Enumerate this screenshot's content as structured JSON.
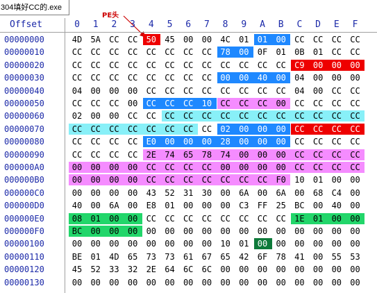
{
  "window": {
    "tab_title": "304填好CC的.exe"
  },
  "annotation": {
    "text": "PE头"
  },
  "header": {
    "offset_label": "Offset",
    "columns": [
      "0",
      "1",
      "2",
      "3",
      "4",
      "5",
      "6",
      "7",
      "8",
      "9",
      "A",
      "B",
      "C",
      "D",
      "E",
      "F"
    ]
  },
  "highlight_colors": {
    "blue": "#1e88ff",
    "red": "#ee0000",
    "magenta": "#f58cff",
    "cyan": "#88f0f8",
    "green": "#22d66a",
    "dark_green": "#0e7a3a"
  },
  "rows": [
    {
      "offset": "00000000",
      "bytes": [
        "4D",
        "5A",
        "CC",
        "CC",
        "50",
        "45",
        "00",
        "00",
        "4C",
        "01",
        "01",
        "00",
        "CC",
        "CC",
        "CC",
        "CC"
      ],
      "highlights": [
        {
          "from": 4,
          "to": 4,
          "color": "red"
        },
        {
          "from": 10,
          "to": 11,
          "color": "blue"
        }
      ]
    },
    {
      "offset": "00000010",
      "bytes": [
        "CC",
        "CC",
        "CC",
        "CC",
        "CC",
        "CC",
        "CC",
        "CC",
        "78",
        "00",
        "0F",
        "01",
        "0B",
        "01",
        "CC",
        "CC"
      ],
      "highlights": [
        {
          "from": 8,
          "to": 9,
          "color": "blue"
        }
      ]
    },
    {
      "offset": "00000020",
      "bytes": [
        "CC",
        "CC",
        "CC",
        "CC",
        "CC",
        "CC",
        "CC",
        "CC",
        "CC",
        "CC",
        "CC",
        "CC",
        "C9",
        "00",
        "00",
        "00"
      ],
      "highlights": [
        {
          "from": 12,
          "to": 15,
          "color": "red"
        }
      ]
    },
    {
      "offset": "00000030",
      "bytes": [
        "CC",
        "CC",
        "CC",
        "CC",
        "CC",
        "CC",
        "CC",
        "CC",
        "00",
        "00",
        "40",
        "00",
        "04",
        "00",
        "00",
        "00"
      ],
      "highlights": [
        {
          "from": 8,
          "to": 11,
          "color": "blue"
        }
      ]
    },
    {
      "offset": "00000040",
      "bytes": [
        "04",
        "00",
        "00",
        "00",
        "CC",
        "CC",
        "CC",
        "CC",
        "CC",
        "CC",
        "CC",
        "CC",
        "04",
        "00",
        "CC",
        "CC"
      ],
      "highlights": []
    },
    {
      "offset": "00000050",
      "bytes": [
        "CC",
        "CC",
        "CC",
        "00",
        "CC",
        "CC",
        "CC",
        "10",
        "CC",
        "CC",
        "CC",
        "00",
        "CC",
        "CC",
        "CC",
        "CC"
      ],
      "highlights": [
        {
          "from": 4,
          "to": 7,
          "color": "blue"
        },
        {
          "from": 8,
          "to": 11,
          "color": "magenta"
        }
      ]
    },
    {
      "offset": "00000060",
      "bytes": [
        "02",
        "00",
        "00",
        "CC",
        "CC",
        "CC",
        "CC",
        "CC",
        "CC",
        "CC",
        "CC",
        "CC",
        "CC",
        "CC",
        "CC",
        "CC"
      ],
      "highlights": [
        {
          "from": 5,
          "to": 15,
          "color": "cyan"
        }
      ]
    },
    {
      "offset": "00000070",
      "bytes": [
        "CC",
        "CC",
        "CC",
        "CC",
        "CC",
        "CC",
        "CC",
        "CC",
        "02",
        "00",
        "00",
        "00",
        "CC",
        "CC",
        "CC",
        "CC"
      ],
      "highlights": [
        {
          "from": 0,
          "to": 6,
          "color": "cyan"
        },
        {
          "from": 8,
          "to": 11,
          "color": "blue"
        },
        {
          "from": 12,
          "to": 15,
          "color": "red"
        }
      ]
    },
    {
      "offset": "00000080",
      "bytes": [
        "CC",
        "CC",
        "CC",
        "CC",
        "E0",
        "00",
        "00",
        "00",
        "28",
        "00",
        "00",
        "00",
        "CC",
        "CC",
        "CC",
        "CC"
      ],
      "highlights": [
        {
          "from": 4,
          "to": 11,
          "color": "blue"
        }
      ]
    },
    {
      "offset": "00000090",
      "bytes": [
        "CC",
        "CC",
        "CC",
        "CC",
        "2E",
        "74",
        "65",
        "78",
        "74",
        "00",
        "00",
        "00",
        "CC",
        "CC",
        "CC",
        "CC"
      ],
      "highlights": [
        {
          "from": 4,
          "to": 15,
          "color": "magenta"
        }
      ]
    },
    {
      "offset": "000000A0",
      "bytes": [
        "00",
        "00",
        "00",
        "00",
        "CC",
        "CC",
        "CC",
        "CC",
        "00",
        "00",
        "00",
        "00",
        "CC",
        "CC",
        "CC",
        "CC"
      ],
      "highlights": [
        {
          "from": 0,
          "to": 15,
          "color": "magenta"
        }
      ]
    },
    {
      "offset": "000000B0",
      "bytes": [
        "00",
        "00",
        "00",
        "00",
        "CC",
        "CC",
        "CC",
        "CC",
        "CC",
        "CC",
        "CC",
        "F0",
        "10",
        "01",
        "00",
        "00"
      ],
      "highlights": [
        {
          "from": 0,
          "to": 11,
          "color": "magenta"
        }
      ]
    },
    {
      "offset": "000000C0",
      "bytes": [
        "00",
        "00",
        "00",
        "00",
        "43",
        "52",
        "31",
        "30",
        "00",
        "6A",
        "00",
        "6A",
        "00",
        "68",
        "C4",
        "00"
      ],
      "highlights": []
    },
    {
      "offset": "000000D0",
      "bytes": [
        "40",
        "00",
        "6A",
        "00",
        "E8",
        "01",
        "00",
        "00",
        "00",
        "C3",
        "FF",
        "25",
        "BC",
        "00",
        "40",
        "00"
      ],
      "highlights": []
    },
    {
      "offset": "000000E0",
      "bytes": [
        "08",
        "01",
        "00",
        "00",
        "CC",
        "CC",
        "CC",
        "CC",
        "CC",
        "CC",
        "CC",
        "CC",
        "1E",
        "01",
        "00",
        "00"
      ],
      "highlights": [
        {
          "from": 0,
          "to": 3,
          "color": "green"
        },
        {
          "from": 12,
          "to": 15,
          "color": "green"
        }
      ]
    },
    {
      "offset": "000000F0",
      "bytes": [
        "BC",
        "00",
        "00",
        "00",
        "00",
        "00",
        "00",
        "00",
        "00",
        "00",
        "00",
        "00",
        "00",
        "00",
        "00",
        "00"
      ],
      "highlights": [
        {
          "from": 0,
          "to": 3,
          "color": "green"
        }
      ]
    },
    {
      "offset": "00000100",
      "bytes": [
        "00",
        "00",
        "00",
        "00",
        "00",
        "00",
        "00",
        "00",
        "10",
        "01",
        "00",
        "00",
        "00",
        "00",
        "00",
        "00"
      ],
      "highlights": [
        {
          "from": 10,
          "to": 10,
          "color": "dark_green"
        }
      ]
    },
    {
      "offset": "00000110",
      "bytes": [
        "BE",
        "01",
        "4D",
        "65",
        "73",
        "73",
        "61",
        "67",
        "65",
        "42",
        "6F",
        "78",
        "41",
        "00",
        "55",
        "53"
      ],
      "highlights": []
    },
    {
      "offset": "00000120",
      "bytes": [
        "45",
        "52",
        "33",
        "32",
        "2E",
        "64",
        "6C",
        "6C",
        "00",
        "00",
        "00",
        "00",
        "00",
        "00",
        "00",
        "00"
      ],
      "highlights": []
    },
    {
      "offset": "00000130",
      "bytes": [
        "00",
        "00",
        "00",
        "00",
        "00",
        "00",
        "00",
        "00",
        "00",
        "00",
        "00",
        "00",
        "00",
        "00",
        "00",
        "00"
      ],
      "highlights": []
    }
  ]
}
